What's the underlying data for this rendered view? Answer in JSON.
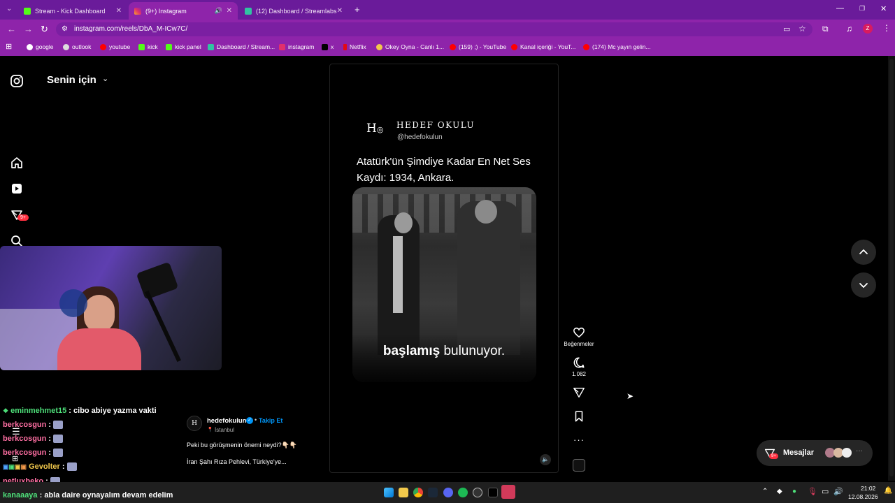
{
  "browser": {
    "tabs": [
      {
        "title": "Stream - Kick Dashboard",
        "color": "#53fc18"
      },
      {
        "title": "(9+) Instagram",
        "color": "#e1306c"
      },
      {
        "title": "(12) Dashboard / Streamlabs",
        "color": "#31c3a2"
      }
    ],
    "url": "instagram.com/reels/DbA_M-ICw7C/",
    "bookmarks": [
      "google",
      "outlook",
      "youtube",
      "kick",
      "kick panel",
      "Dashboard / Stream...",
      "instagram",
      "x",
      "Netflix",
      "Okey Oyna - Canlı 1...",
      "(159) ;) - YouTube",
      "Kanal içeriği - YouT...",
      "(174) Mc yayın gelin..."
    ],
    "profile_initial": "Z"
  },
  "instagram": {
    "feed_title": "Senin için",
    "notification_badge": "9+",
    "reel": {
      "brand_name": "HEDEF OKULU",
      "brand_handle": "@hedefokulun",
      "headline": "Atatürk'ün Şimdiye Kadar En Net Ses Kaydı: 1934, Ankara.",
      "subtitle_bold": "başlamış",
      "subtitle_rest": "bulunuyor."
    },
    "post": {
      "username": "hedefokulun",
      "follow_label": "Takip Et",
      "location": "İstanbul",
      "caption_1": "Peki bu görüşmenin önemi neydi?👇🏻👇🏻",
      "caption_2": "İran Şahı Rıza Pehlevi, Türkiye'ye..."
    },
    "actions": {
      "likes_label": "Beğenmeler",
      "comments_count": "1.082"
    },
    "messages_label": "Mesajlar",
    "messages_badge": "9+"
  },
  "chat": [
    {
      "user": "eminmehmet15",
      "text": ": cibo abiye yazma vakti",
      "color": "#4ee07a"
    },
    {
      "user": "berkcosgun",
      "text": ":",
      "color": "#ff6fa3"
    },
    {
      "user": "berkcosgun",
      "text": ":",
      "color": "#ff6fa3"
    },
    {
      "user": "berkcosgun",
      "text": ":",
      "color": "#ff6fa3"
    },
    {
      "user": "Gevolter",
      "text": ":",
      "color": "#f2c94c"
    },
    {
      "user": "netluxbeko",
      "text": ":",
      "color": "#ff6fa3"
    },
    {
      "user": "kanaaaya",
      "text": ": abla daire oynayalım devam edelim",
      "color": "#4ee07a"
    }
  ],
  "taskbar": {
    "time": "21:02",
    "date": "12.08.2026"
  }
}
